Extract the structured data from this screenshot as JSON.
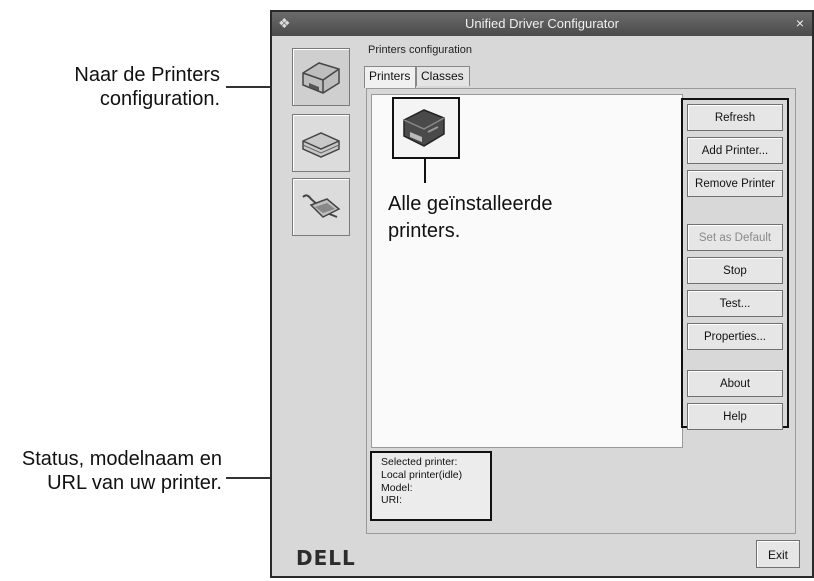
{
  "callouts": {
    "printers_config": [
      "Naar de Printers",
      "configuration."
    ],
    "status": [
      "Status, modelnaam en",
      "URL van uw printer."
    ],
    "installed": [
      "Alle geïnstalleerde",
      "printers."
    ]
  },
  "window": {
    "title": "Unified Driver Configurator",
    "close_glyph": "×"
  },
  "section_title": "Printers configuration",
  "tabs": [
    "Printers",
    "Classes"
  ],
  "buttons": {
    "refresh": "Refresh",
    "add_printer": "Add Printer...",
    "remove_printer": "Remove Printer",
    "set_default": "Set as Default",
    "stop": "Stop",
    "test": "Test...",
    "properties": "Properties...",
    "about": "About",
    "help": "Help",
    "exit": "Exit"
  },
  "status_panel": {
    "selected": "Selected printer:",
    "local": "Local printer(idle)",
    "model": "Model:",
    "uri": "URI:"
  },
  "logo": "DELL",
  "icons": {
    "sidebar": [
      "printer-icon",
      "scanner-icon",
      "port-icon"
    ],
    "list_item": "printer-icon"
  }
}
